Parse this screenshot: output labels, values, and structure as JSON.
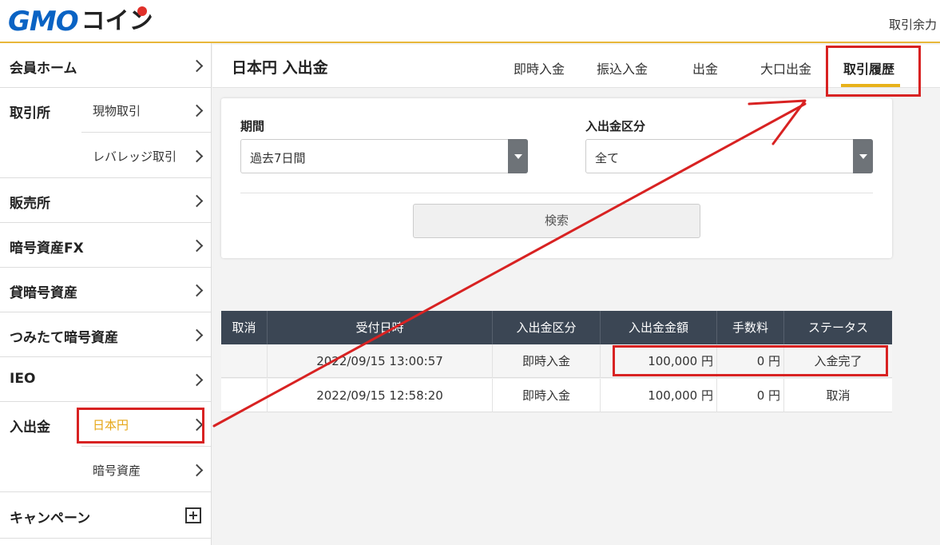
{
  "header": {
    "logo_gmo": "GMO",
    "logo_coin": "コイン",
    "right_text": "取引余力"
  },
  "sidebar": {
    "member_home": "会員ホーム",
    "exchange": {
      "label": "取引所",
      "items": [
        "現物取引",
        "レバレッジ取引"
      ]
    },
    "sales": "販売所",
    "crypto_fx": "暗号資産FX",
    "lending": "貸暗号資産",
    "accumulate": "つみたて暗号資産",
    "ieo": "IEO",
    "deposit": {
      "label": "入出金",
      "items": [
        "日本円",
        "暗号資産"
      ]
    },
    "campaign": "キャンペーン"
  },
  "page": {
    "title": "日本円 入出金",
    "tabs": [
      "即時入金",
      "振込入金",
      "出金",
      "大口出金",
      "取引履歴"
    ],
    "active_tab": "取引履歴"
  },
  "filters": {
    "period_label": "期間",
    "period_value": "過去7日間",
    "type_label": "入出金区分",
    "type_value": "全て",
    "search_label": "検索"
  },
  "table": {
    "headers": [
      "取消",
      "受付日時",
      "入出金区分",
      "入出金金額",
      "手数料",
      "ステータス"
    ],
    "rows": [
      {
        "cancel": "",
        "datetime": "2022/09/15 13:00:57",
        "type": "即時入金",
        "amount": "100,000 円",
        "fee": "0 円",
        "status": "入金完了"
      },
      {
        "cancel": "",
        "datetime": "2022/09/15 12:58:20",
        "type": "即時入金",
        "amount": "100,000 円",
        "fee": "0 円",
        "status": "取消"
      }
    ]
  },
  "colors": {
    "accent": "#e8b21a",
    "table_header": "#3b4654",
    "annotation": "#d82222",
    "logo_blue": "#0a63c4"
  }
}
